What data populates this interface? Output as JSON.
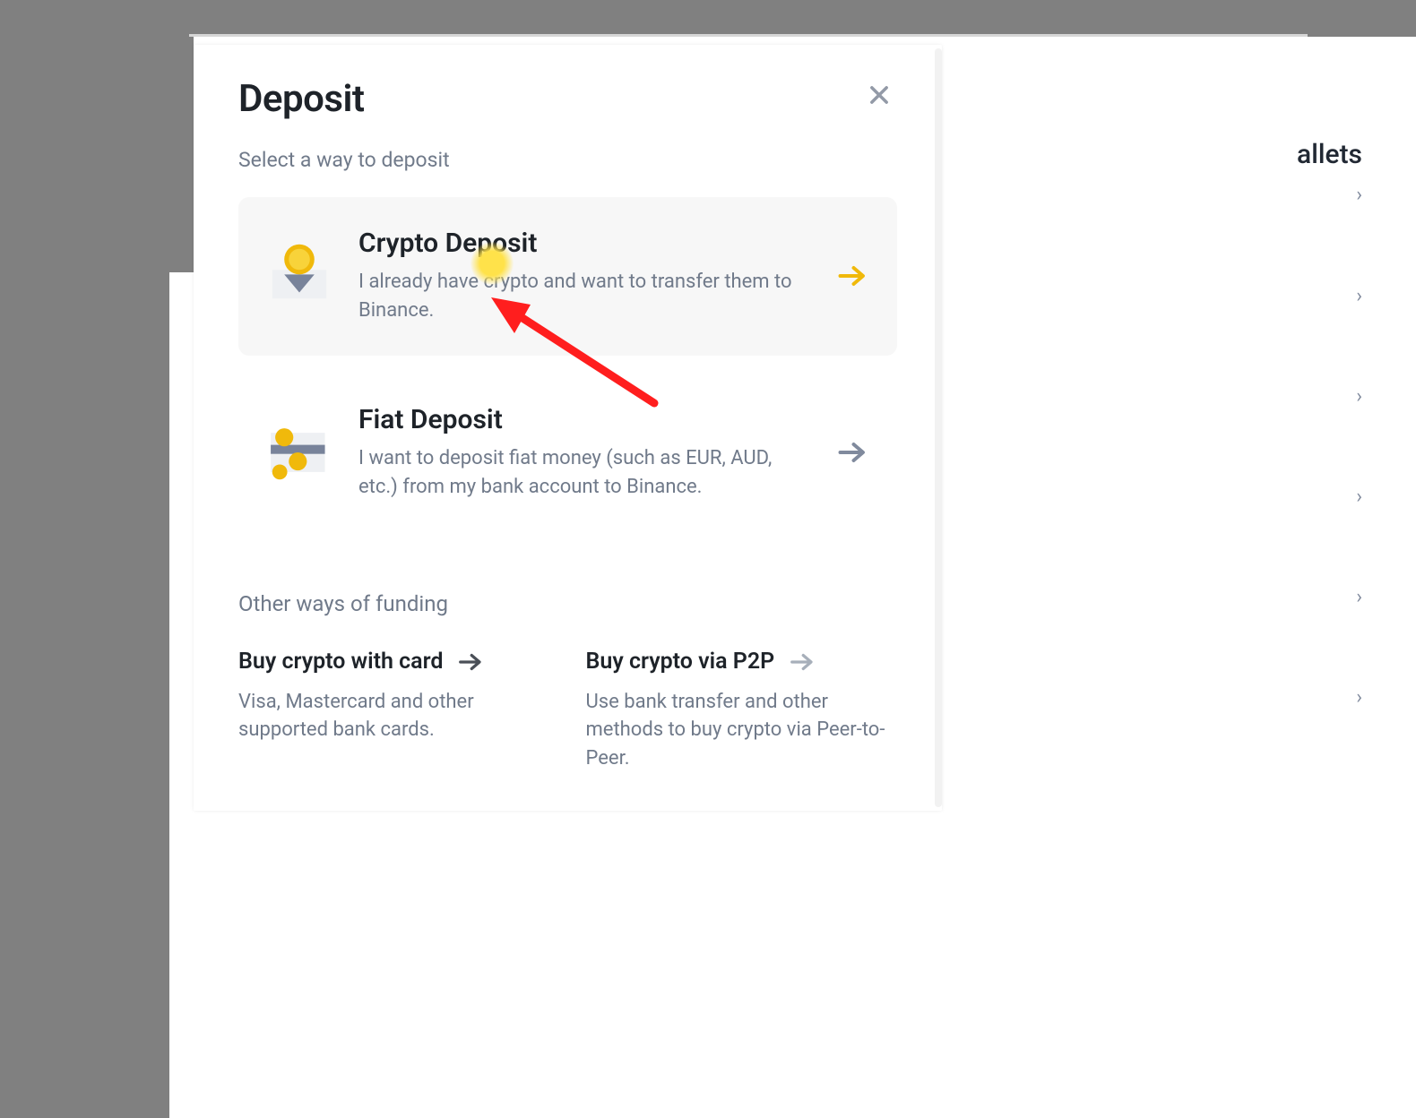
{
  "background": {
    "wallets_label": "allets",
    "chevrons": [
      "›",
      "›",
      "›",
      "›",
      "›",
      "›"
    ]
  },
  "modal": {
    "title": "Deposit",
    "subtitle": "Select a way to deposit",
    "options": [
      {
        "title": "Crypto Deposit",
        "desc": "I already have crypto and want to transfer them to Binance.",
        "highlight": true,
        "arrow_color": "yellow"
      },
      {
        "title": "Fiat Deposit",
        "desc": "I want to deposit fiat money (such as EUR, AUD, etc.) from my bank account to Binance.",
        "highlight": false,
        "arrow_color": "grey"
      }
    ],
    "other_heading": "Other ways of funding",
    "others": [
      {
        "title": "Buy crypto with card",
        "desc": "Visa, Mastercard and other supported bank cards."
      },
      {
        "title": "Buy crypto via P2P",
        "desc": "Use bank transfer and other methods to buy crypto via Peer-to-Peer."
      }
    ]
  }
}
